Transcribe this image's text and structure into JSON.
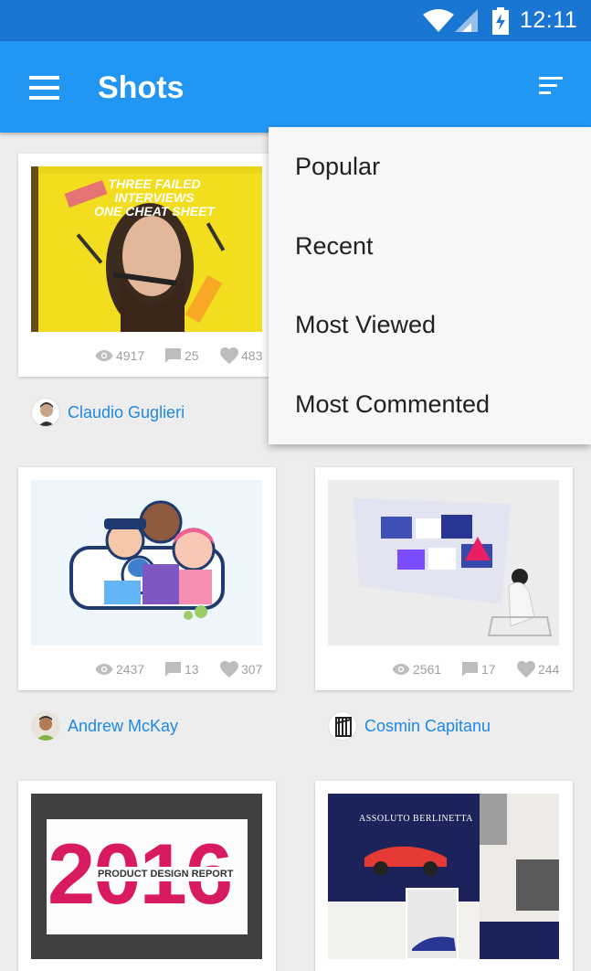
{
  "status_bar": {
    "time": "12:11",
    "icons": [
      "wifi-icon",
      "cell-signal-icon",
      "battery-charging-icon"
    ]
  },
  "app_bar": {
    "title": "Shots",
    "menu_icon": "hamburger-menu-icon",
    "sort_icon": "sort-icon"
  },
  "sort_menu": {
    "items": [
      {
        "label": "Popular"
      },
      {
        "label": "Recent"
      },
      {
        "label": "Most Viewed"
      },
      {
        "label": "Most Commented"
      }
    ]
  },
  "shots": [
    {
      "image_text": "THREE FAILED INTERVIEWS\nONE CHEAT SHEET",
      "views": "4917",
      "comments": "25",
      "likes": "483",
      "author": "Claudio Guglieri"
    },
    {
      "views": "2437",
      "comments": "13",
      "likes": "307",
      "author": "Andrew McKay"
    },
    {
      "views": "2561",
      "comments": "17",
      "likes": "244",
      "author": "Cosmin Capitanu"
    },
    {
      "image_text_big": "2016",
      "image_text": "PRODUCT DESIGN REPORT"
    },
    {
      "image_text": "ASSOLUTO BERLINETTA"
    }
  ],
  "colors": {
    "status_bar": "#1976D2",
    "app_bar": "#2196F3",
    "author_link": "#1E88E5",
    "background": "#EDEDED"
  }
}
